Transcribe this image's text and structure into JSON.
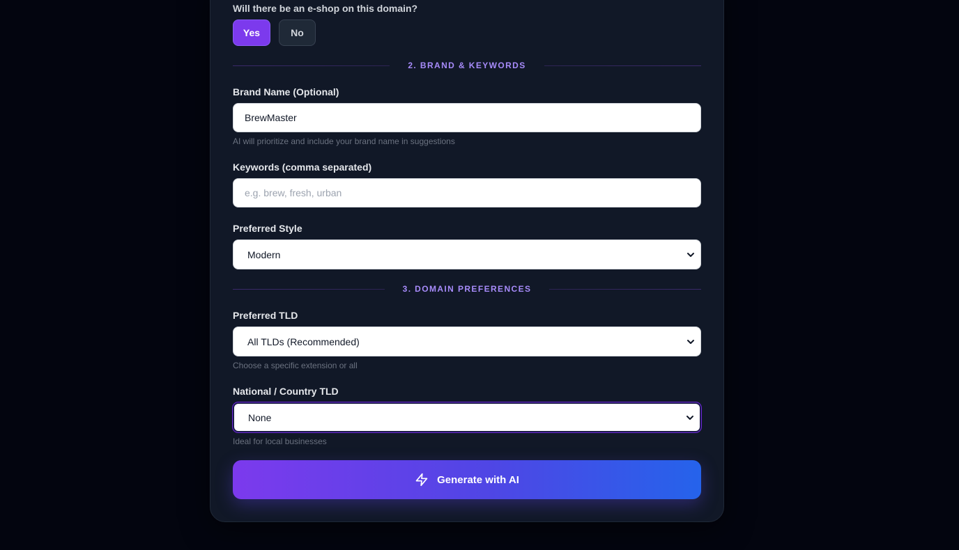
{
  "eshop": {
    "question": "Will there be an e-shop on this domain?",
    "yes_label": "Yes",
    "no_label": "No",
    "selected": "Yes"
  },
  "sections": {
    "brand_keywords": "2. BRAND & KEYWORDS",
    "domain_preferences": "3. DOMAIN PREFERENCES"
  },
  "brand": {
    "label": "Brand Name (Optional)",
    "value": "BrewMaster",
    "hint": "AI will prioritize and include your brand name in suggestions"
  },
  "keywords": {
    "label": "Keywords (comma separated)",
    "value": "",
    "placeholder": "e.g. brew, fresh, urban"
  },
  "style": {
    "label": "Preferred Style",
    "selected": "Modern"
  },
  "tld": {
    "label": "Preferred TLD",
    "selected": "All TLDs (Recommended)",
    "hint": "Choose a specific extension or all"
  },
  "country_tld": {
    "label": "National / Country TLD",
    "selected": "None",
    "hint": "Ideal for local businesses"
  },
  "generate": {
    "label": "Generate with AI",
    "icon": "lightning-bolt-icon"
  },
  "colors": {
    "background": "#03050f",
    "card": "#111827",
    "accent_purple": "#7c3aed",
    "accent_blue": "#2563eb",
    "section_title": "#a78bfa"
  }
}
